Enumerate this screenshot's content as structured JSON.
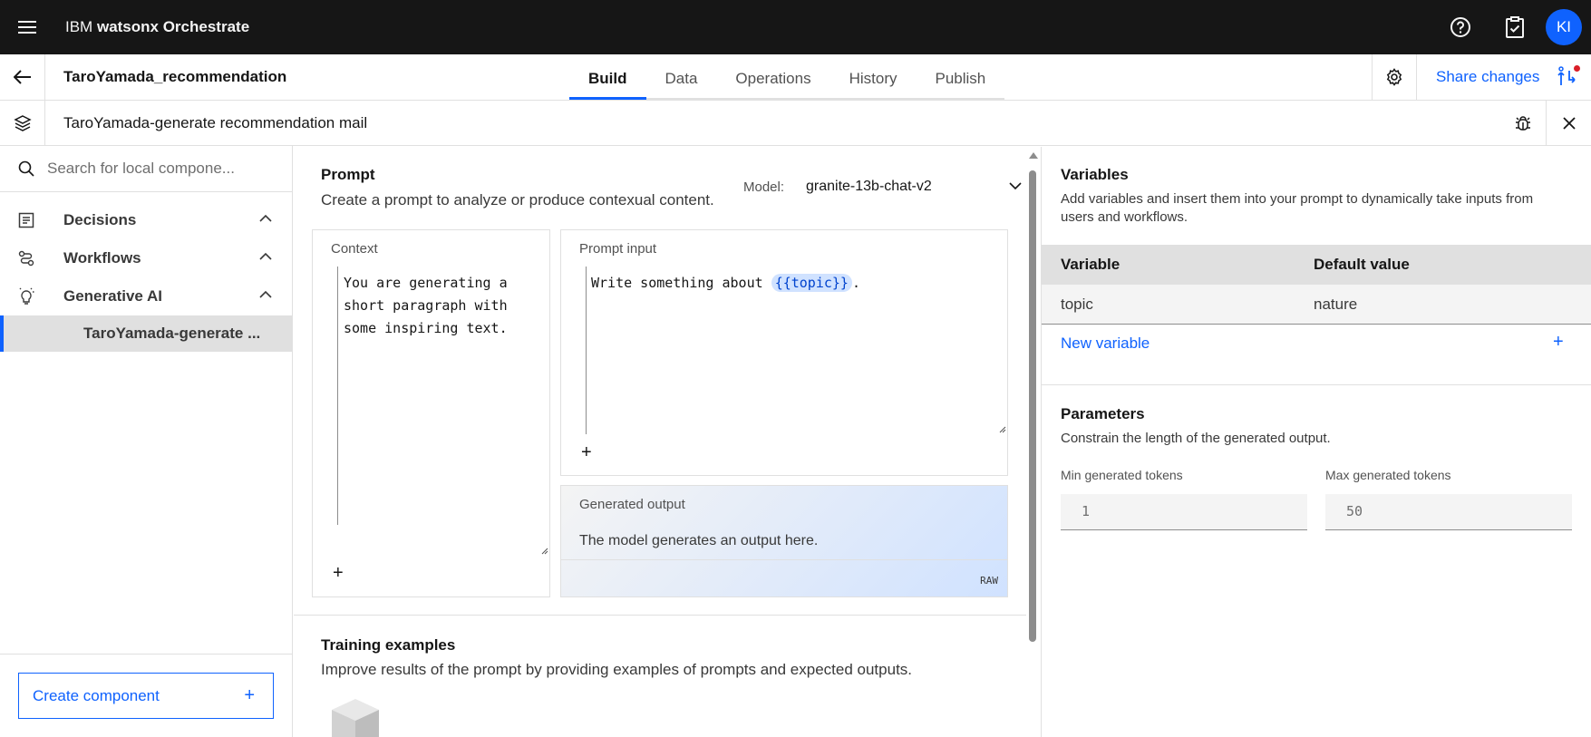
{
  "topbar": {
    "brand_prefix": "IBM",
    "brand_product": "watsonx Orchestrate",
    "avatar_initials": "KI"
  },
  "header": {
    "project_name": "TaroYamada_recommendation",
    "tabs": [
      {
        "label": "Build",
        "active": true
      },
      {
        "label": "Data",
        "active": false
      },
      {
        "label": "Operations",
        "active": false
      },
      {
        "label": "History",
        "active": false
      },
      {
        "label": "Publish",
        "active": false
      }
    ],
    "share_label": "Share changes"
  },
  "component_bar": {
    "title": "TaroYamada-generate recommendation mail"
  },
  "sidebar": {
    "search_placeholder": "Search for local compone...",
    "categories": [
      {
        "label": "Decisions",
        "icon": "decision-table-icon",
        "expanded": true
      },
      {
        "label": "Workflows",
        "icon": "workflow-icon",
        "expanded": true
      },
      {
        "label": "Generative AI",
        "icon": "ai-bulb-icon",
        "expanded": true
      }
    ],
    "selected_item": "TaroYamada-generate ...",
    "create_label": "Create component",
    "create_plus": "+"
  },
  "prompt": {
    "heading": "Prompt",
    "description": "Create a prompt to analyze or produce contexual content.",
    "model_label": "Model:",
    "model_value": "granite-13b-chat-v2",
    "context": {
      "title": "Context",
      "text": "You are generating a\nshort paragraph with\nsome inspiring text.",
      "plus": "+"
    },
    "prompt_input": {
      "title": "Prompt input",
      "text_before": "Write something about ",
      "variable_chip": "{{topic}}",
      "text_after": ".",
      "plus": "+"
    },
    "generated_output": {
      "title": "Generated output",
      "text": "The model generates an output here.",
      "raw_label": "RAW"
    }
  },
  "training": {
    "heading": "Training examples",
    "description": "Improve results of the prompt by providing examples of prompts and expected outputs."
  },
  "variables": {
    "heading": "Variables",
    "description": "Add variables and insert them into your prompt to dynamically take inputs from users and workflows.",
    "columns": [
      "Variable",
      "Default value"
    ],
    "rows": [
      {
        "name": "topic",
        "default": "nature"
      }
    ],
    "new_label": "New variable",
    "new_plus": "+"
  },
  "parameters": {
    "heading": "Parameters",
    "description": "Constrain the length of the generated output.",
    "min_label": "Min generated tokens",
    "min_value": "1",
    "max_label": "Max generated tokens",
    "max_value": "50"
  },
  "colors": {
    "accent": "#0f62fe",
    "topbar": "#161616",
    "notification": "#da1e28"
  }
}
